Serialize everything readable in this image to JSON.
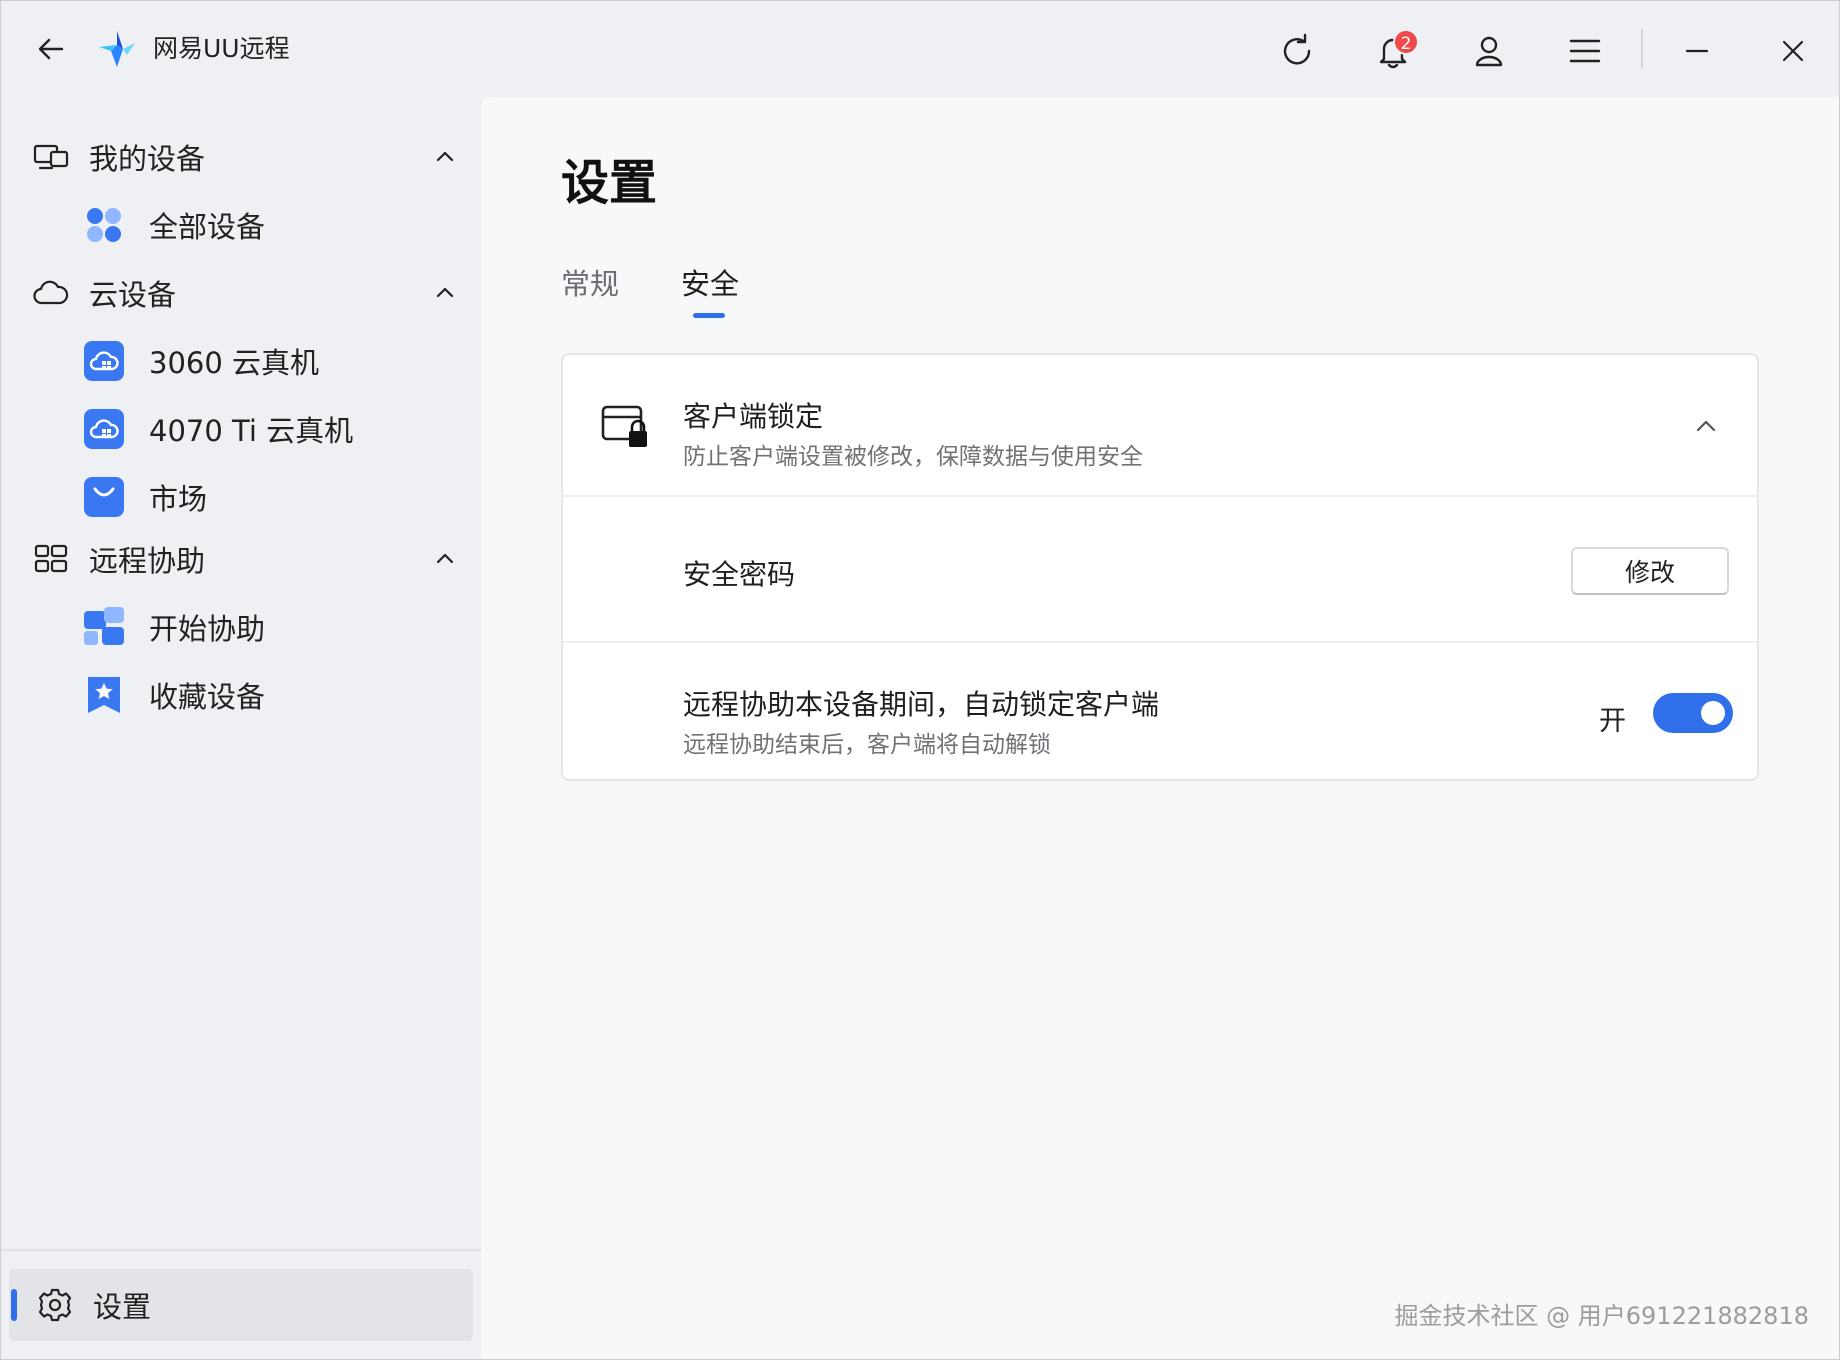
{
  "app": {
    "title": "网易UU远程",
    "notification_count": "2",
    "brand_color": "#2f6fea"
  },
  "titlebar": {
    "icons": [
      "back-arrow-icon",
      "refresh-icon",
      "bell-icon",
      "user-icon",
      "menu-icon",
      "minimize-icon",
      "close-icon"
    ]
  },
  "sidebar": {
    "my_devices": {
      "label": "我的设备",
      "items": [
        {
          "label": "全部设备",
          "icon": "all-devices-icon"
        }
      ]
    },
    "cloud_devices": {
      "label": "云设备",
      "items": [
        {
          "label": "3060 云真机",
          "icon": "cloud-machine-icon"
        },
        {
          "label": "4070 Ti 云真机",
          "icon": "cloud-machine-icon"
        },
        {
          "label": "市场",
          "icon": "market-bag-icon"
        }
      ]
    },
    "remote_assist": {
      "label": "远程协助",
      "items": [
        {
          "label": "开始协助",
          "icon": "start-assist-icon"
        },
        {
          "label": "收藏设备",
          "icon": "favorite-star-icon"
        }
      ]
    },
    "settings_label": "设置"
  },
  "main": {
    "title": "设置",
    "tabs": [
      {
        "label": "常规",
        "active": false
      },
      {
        "label": "安全",
        "active": true
      }
    ],
    "client_lock": {
      "title": "客户端锁定",
      "subtitle": "防止客户端设置被修改，保障数据与使用安全",
      "password_label": "安全密码",
      "modify_button": "修改",
      "auto_lock_title": "远程协助本设备期间，自动锁定客户端",
      "auto_lock_subtitle": "远程协助结束后，客户端将自动解锁",
      "toggle_label": "开",
      "toggle_on": true
    }
  },
  "watermark": "掘金技术社区 @ 用户691221882818"
}
